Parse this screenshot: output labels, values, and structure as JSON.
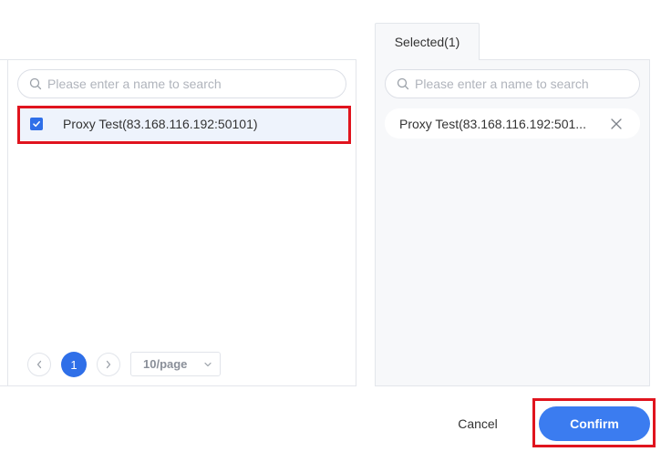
{
  "left": {
    "search_placeholder": "Please enter a name to search",
    "items": [
      {
        "label": "Proxy Test(83.168.116.192:50101)",
        "checked": true
      }
    ],
    "pagination": {
      "current_page": "1",
      "page_size": "10/page"
    }
  },
  "right": {
    "tab_label": "Selected(1)",
    "search_placeholder": "Please enter a name to search",
    "selected": [
      {
        "label": "Proxy Test(83.168.116.192:501..."
      }
    ]
  },
  "footer": {
    "cancel_label": "Cancel",
    "confirm_label": "Confirm"
  },
  "colors": {
    "primary": "#2f6fe8",
    "highlight": "#e0141e"
  }
}
